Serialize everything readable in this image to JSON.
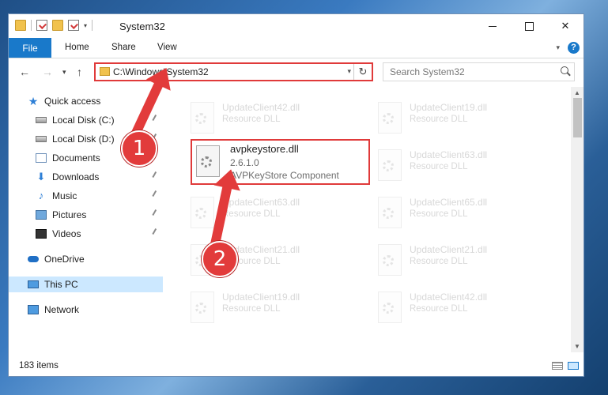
{
  "window": {
    "title": "System32",
    "controls": {
      "minimize": "—",
      "maximize": "□",
      "close": "✕"
    }
  },
  "ribbon": {
    "tabs": [
      "File",
      "Home",
      "Share",
      "View"
    ],
    "help": "?"
  },
  "address": {
    "path": "C:\\Windows\\System32",
    "search_placeholder": "Search System32"
  },
  "sidebar": {
    "items": [
      {
        "label": "Quick access",
        "icon": "star-icon"
      },
      {
        "label": "Local Disk (C:)",
        "icon": "disk-icon"
      },
      {
        "label": "Local Disk (D:)",
        "icon": "disk-icon"
      },
      {
        "label": "Documents",
        "icon": "documents-icon"
      },
      {
        "label": "Downloads",
        "icon": "downloads-icon"
      },
      {
        "label": "Music",
        "icon": "music-icon"
      },
      {
        "label": "Pictures",
        "icon": "pictures-icon"
      },
      {
        "label": "Videos",
        "icon": "videos-icon"
      },
      {
        "label": "OneDrive",
        "icon": "cloud-icon"
      },
      {
        "label": "This PC",
        "icon": "pc-icon"
      },
      {
        "label": "Network",
        "icon": "network-icon"
      }
    ]
  },
  "files": {
    "background": [
      {
        "name": "UpdateClient42.dll",
        "desc": "Resource DLL"
      },
      {
        "name": "UpdateClient19.dll",
        "desc": "Resource DLL"
      },
      {
        "name": "UpdateClient63.dll",
        "desc": "Resource DLL"
      },
      {
        "name": "UpdateClient63.dll",
        "desc": "Resource DLL"
      },
      {
        "name": "UpdateClient65.dll",
        "desc": "Resource DLL"
      },
      {
        "name": "UpdateClient21.dll",
        "desc": "Resource DLL"
      },
      {
        "name": "UpdateClient21.dll",
        "desc": "Resource DLL"
      },
      {
        "name": "UpdateClient19.dll",
        "desc": "Resource DLL"
      },
      {
        "name": "UpdateClient42.dll",
        "desc": "Resource DLL"
      }
    ],
    "highlighted": {
      "name": "avpkeystore.dll",
      "version": "2.6.1.0",
      "desc": "AVPKeyStore Component"
    }
  },
  "status": {
    "count": "183 items"
  },
  "annotations": {
    "step1": "1",
    "step2": "2",
    "color": "#e23b3b"
  }
}
